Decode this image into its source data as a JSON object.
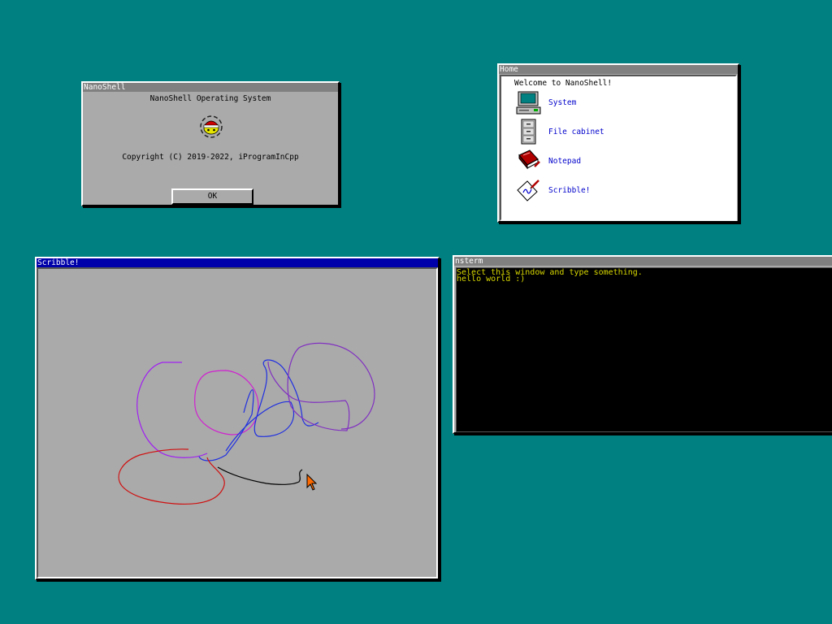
{
  "colors": {
    "desktop": "#008080",
    "window_face": "#aaaaaa",
    "titlebar_inactive": "#808080",
    "titlebar_active": "#0000aa",
    "link_text": "#0000cc",
    "terminal_bg": "#000000",
    "terminal_text": "#d7d700"
  },
  "about_window": {
    "title": "NanoShell",
    "heading": "NanoShell Operating System",
    "logo_icon": "nanoshell-logo-icon",
    "copyright": "Copyright (C) 2019-2022, iProgramInCpp",
    "ok_label": "OK"
  },
  "home_window": {
    "title": "Home",
    "welcome": "Welcome to NanoShell!",
    "items": [
      {
        "label": "System",
        "icon": "computer-icon"
      },
      {
        "label": "File cabinet",
        "icon": "file-cabinet-icon"
      },
      {
        "label": "Notepad",
        "icon": "notepad-book-icon"
      },
      {
        "label": "Scribble!",
        "icon": "scribble-icon"
      }
    ]
  },
  "scribble_window": {
    "title": "Scribble!"
  },
  "terminal_window": {
    "title": "nsterm",
    "lines": [
      "Select this window and type something.",
      "hello world :)"
    ]
  }
}
